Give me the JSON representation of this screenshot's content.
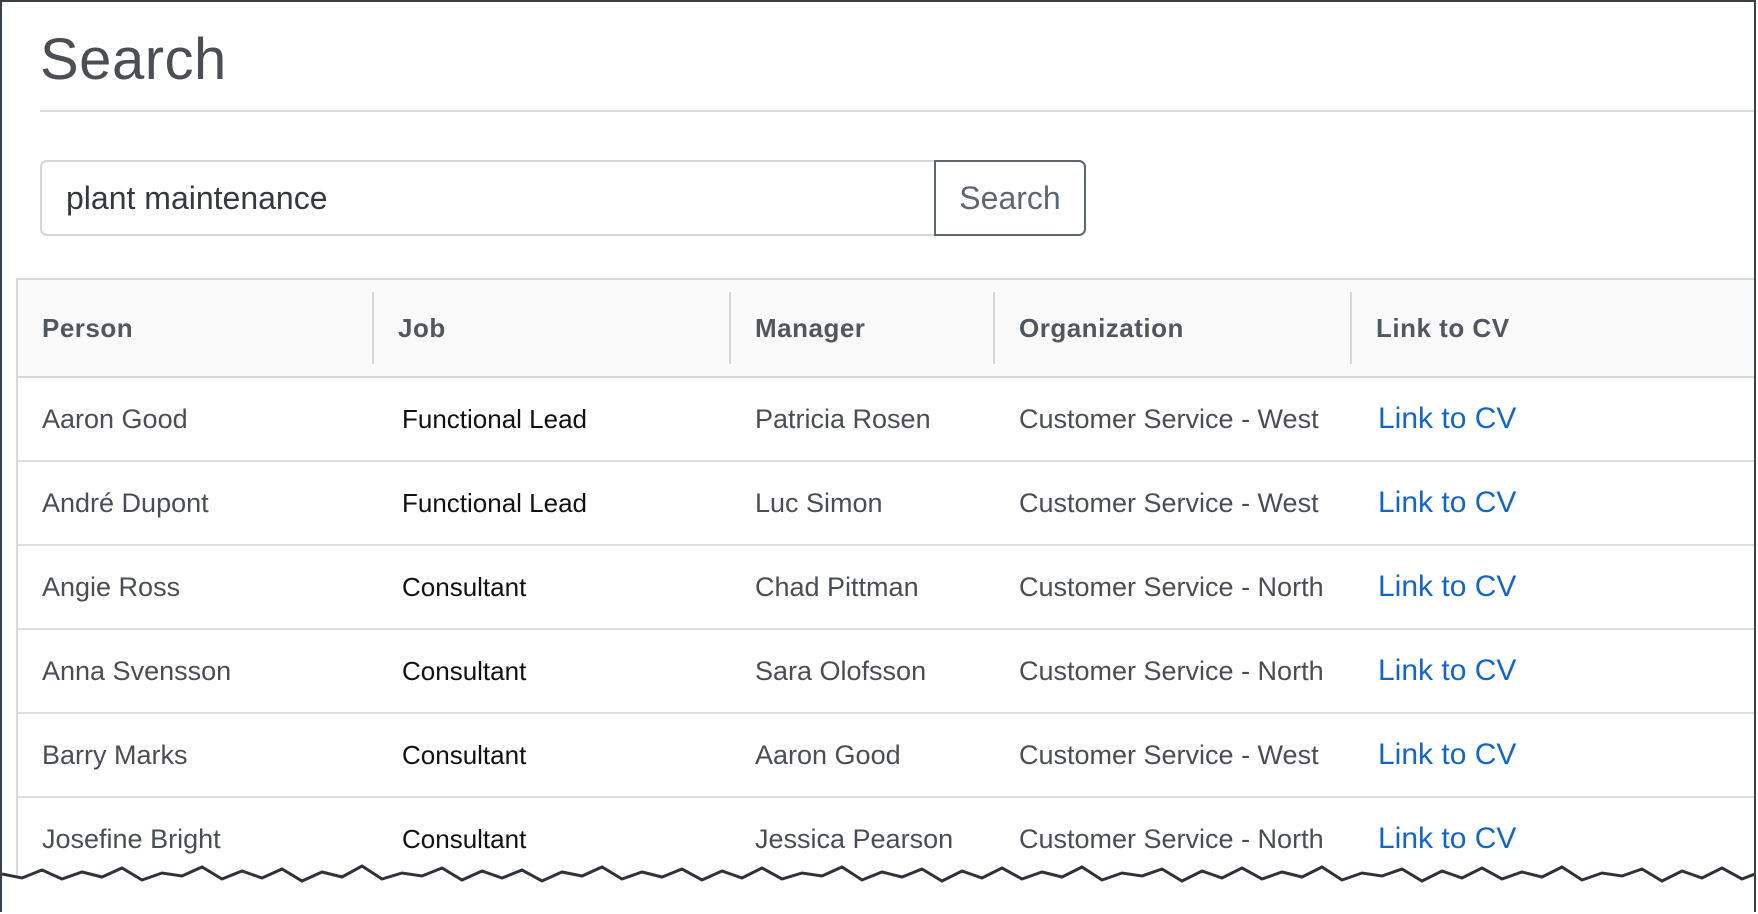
{
  "page": {
    "title": "Search"
  },
  "search": {
    "value": "plant maintenance",
    "button_label": "Search"
  },
  "table": {
    "columns": [
      "Person",
      "Job",
      "Manager",
      "Organization",
      "Link to CV"
    ],
    "rows": [
      {
        "person": "Aaron Good",
        "job": "Functional Lead",
        "manager": "Patricia Rosen",
        "organization": "Customer Service - West",
        "link": "Link to CV"
      },
      {
        "person": "André Dupont",
        "job": "Functional Lead",
        "manager": "Luc Simon",
        "organization": "Customer Service - West",
        "link": "Link to CV"
      },
      {
        "person": "Angie Ross",
        "job": "Consultant",
        "manager": "Chad Pittman",
        "organization": "Customer Service - North",
        "link": "Link to CV"
      },
      {
        "person": "Anna Svensson",
        "job": "Consultant",
        "manager": "Sara Olofsson",
        "organization": "Customer Service - North",
        "link": "Link to CV"
      },
      {
        "person": "Barry Marks",
        "job": "Consultant",
        "manager": "Aaron Good",
        "organization": "Customer Service - West",
        "link": "Link to CV"
      },
      {
        "person": "Josefine Bright",
        "job": "Consultant",
        "manager": "Jessica Pearson",
        "organization": "Customer Service - North",
        "link": "Link to CV"
      }
    ]
  },
  "colors": {
    "link": "#1366c8",
    "text": "#4a4e54",
    "header_bg": "#fafafa"
  }
}
